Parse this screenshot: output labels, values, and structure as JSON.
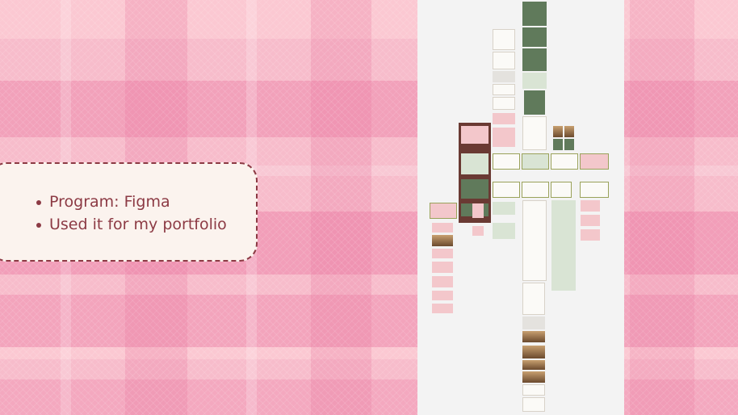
{
  "slide": {
    "bullets": [
      "Program: Figma",
      "Used it for my portfolio"
    ]
  },
  "colors": {
    "accent": "#8c3a44",
    "callout_bg": "#fbf3ee",
    "canvas_bg": "#f3f3f3",
    "plaid_base": "#f7bccb"
  }
}
